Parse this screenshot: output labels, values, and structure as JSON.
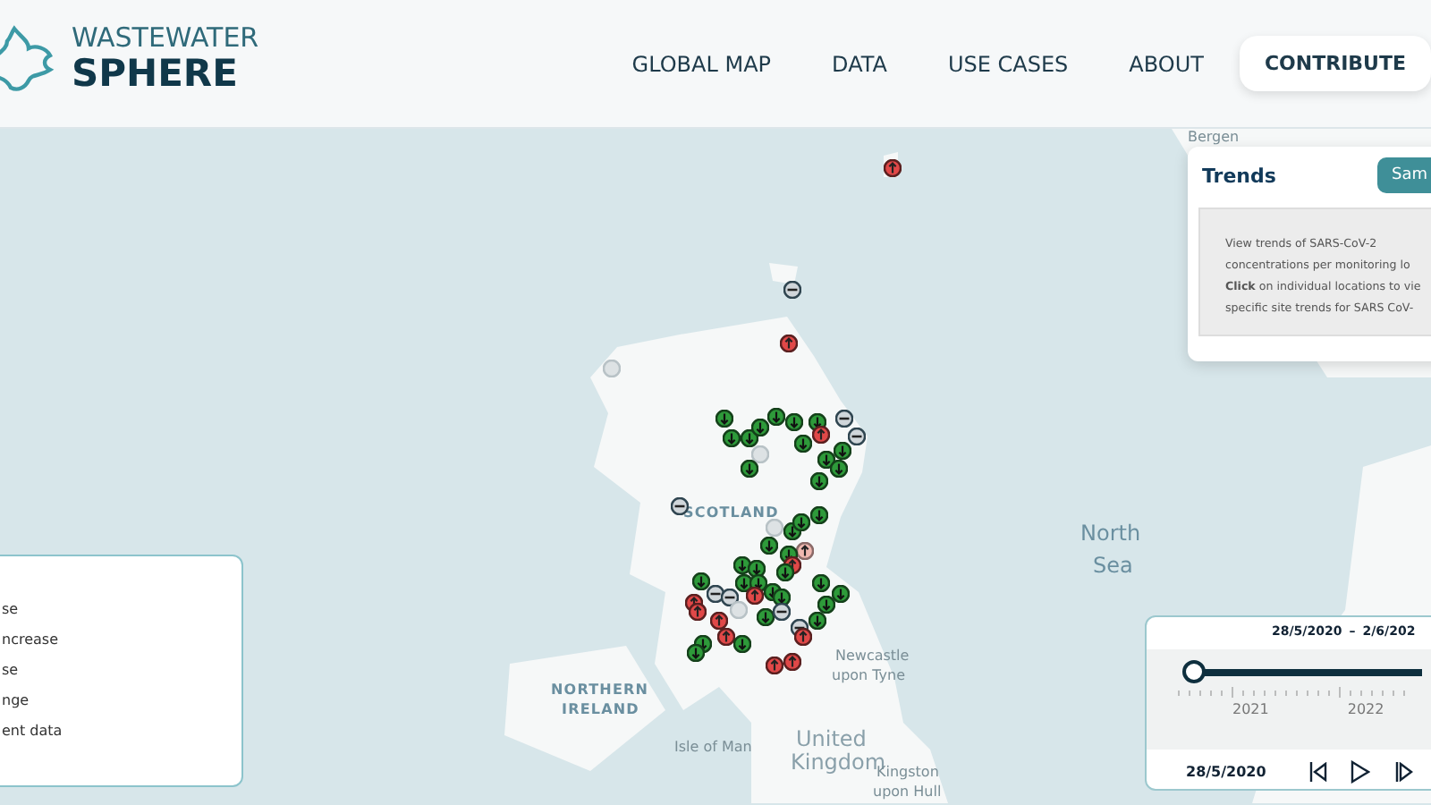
{
  "logo": {
    "line_1": "WASTEWATER",
    "line_2": "SPHERE"
  },
  "nav": [
    {
      "label": "GLOBAL MAP",
      "selected": false
    },
    {
      "label": "DATA",
      "selected": false
    },
    {
      "label": "USE CASES",
      "selected": false
    },
    {
      "label": "ABOUT",
      "selected": false
    },
    {
      "label": "CONTRIBUTE",
      "selected": true
    }
  ],
  "map_labels": [
    {
      "text": "Bergen",
      "kind": "city"
    },
    {
      "text": "SCOTLAND",
      "kind": "country"
    },
    {
      "text": "North",
      "kind": "sea"
    },
    {
      "text": "Sea",
      "kind": "sea"
    },
    {
      "text": "NORTHERN",
      "kind": "country"
    },
    {
      "text": "IRELAND",
      "kind": "country"
    },
    {
      "text": "Newcastle",
      "kind": "city"
    },
    {
      "text": "upon Tyne",
      "kind": "city"
    },
    {
      "text": "United",
      "kind": "region"
    },
    {
      "text": "Kingdom",
      "kind": "region"
    },
    {
      "text": "Isle of Man",
      "kind": "city"
    },
    {
      "text": "Kingston",
      "kind": "city"
    },
    {
      "text": "upon Hull",
      "kind": "city"
    }
  ],
  "markers": [
    {
      "kind": "increase"
    },
    {
      "kind": "no-change"
    },
    {
      "kind": "increase"
    },
    {
      "kind": "no-data"
    },
    {
      "kind": "decrease"
    },
    {
      "kind": "decrease"
    },
    {
      "kind": "decrease"
    },
    {
      "kind": "decrease"
    },
    {
      "kind": "no-change"
    },
    {
      "kind": "increase"
    },
    {
      "kind": "no-change"
    },
    {
      "kind": "decrease"
    },
    {
      "kind": "decrease"
    },
    {
      "kind": "decrease"
    },
    {
      "kind": "decrease"
    },
    {
      "kind": "decrease"
    },
    {
      "kind": "no-data"
    },
    {
      "kind": "decrease"
    },
    {
      "kind": "decrease"
    },
    {
      "kind": "decrease"
    },
    {
      "kind": "decrease"
    },
    {
      "kind": "no-change"
    },
    {
      "kind": "decrease"
    },
    {
      "kind": "no-data"
    },
    {
      "kind": "decrease"
    },
    {
      "kind": "decrease"
    },
    {
      "kind": "decrease"
    },
    {
      "kind": "minor-increase"
    },
    {
      "kind": "decrease"
    },
    {
      "kind": "increase"
    },
    {
      "kind": "decrease"
    },
    {
      "kind": "decrease"
    },
    {
      "kind": "decrease"
    },
    {
      "kind": "decrease"
    },
    {
      "kind": "decrease"
    },
    {
      "kind": "decrease"
    },
    {
      "kind": "decrease"
    },
    {
      "kind": "decrease"
    },
    {
      "kind": "no-change"
    },
    {
      "kind": "no-change"
    },
    {
      "kind": "increase"
    },
    {
      "kind": "increase"
    },
    {
      "kind": "increase"
    },
    {
      "kind": "decrease"
    },
    {
      "kind": "decrease"
    },
    {
      "kind": "decrease"
    },
    {
      "kind": "no-data"
    },
    {
      "kind": "increase"
    },
    {
      "kind": "decrease"
    },
    {
      "kind": "no-change"
    },
    {
      "kind": "no-change"
    },
    {
      "kind": "decrease"
    },
    {
      "kind": "increase"
    },
    {
      "kind": "increase"
    },
    {
      "kind": "decrease"
    },
    {
      "kind": "decrease"
    },
    {
      "kind": "decrease"
    },
    {
      "kind": "increase"
    },
    {
      "kind": "increase"
    }
  ],
  "legend": {
    "items": [
      "se",
      "ncrease",
      "se",
      "nge",
      "ent data"
    ]
  },
  "trends": {
    "title": "Trends",
    "button": "Sam",
    "lines": [
      "View trends of SARS-CoV-2",
      "concentrations per monitoring lo",
      "**Click** on individual locations to vie",
      "specific site trends for SARS CoV-"
    ]
  },
  "timeline": {
    "start": "28/5/2020",
    "separator": "–",
    "end": "2/6/202",
    "level": 0,
    "years": [
      "2021",
      "2022"
    ],
    "current": "28/5/2020"
  }
}
